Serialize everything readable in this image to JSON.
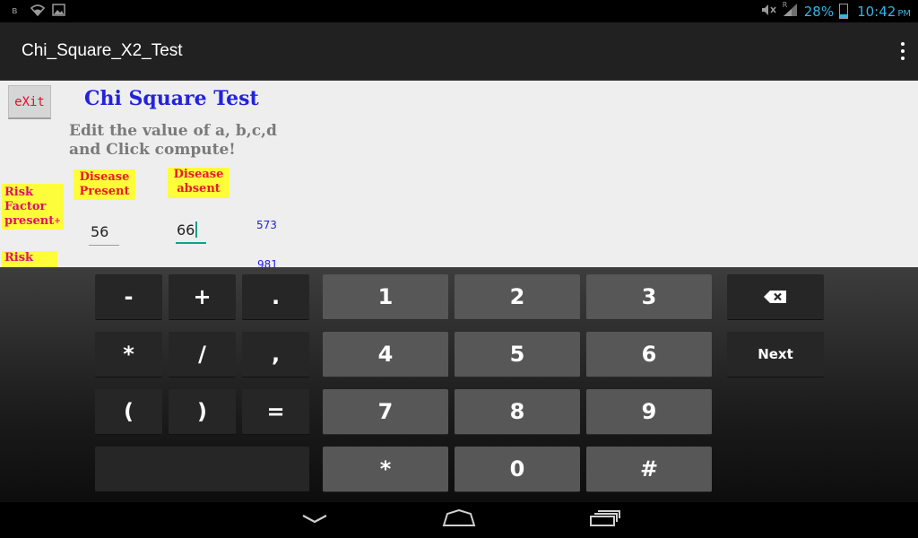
{
  "status_bar": {
    "left_icons": [
      "bluetooth-icon",
      "wifi-icon",
      "image-icon"
    ],
    "bluetooth_glyph": "ʙ",
    "battery_percent": "28%",
    "battery_level": 0.28,
    "time": "10:42",
    "ampm": "PM",
    "signal_label": "R"
  },
  "action_bar": {
    "title": "Chi_Square_X2_Test"
  },
  "content": {
    "exit_label": "eXit",
    "title": "Chi Square Test",
    "instruction_line1": "Edit the value of a, b,c,d",
    "instruction_line2": "and Click compute!",
    "label_disease_present": "Disease Present",
    "label_disease_absent": "Disease absent",
    "label_risk_factor_present": "Risk Factor present",
    "label_risk_factor_present_plus": "+",
    "label_risk_2": "Risk",
    "field_a_value": "56",
    "field_b_value": "66",
    "total_1": "573",
    "total_2": "981"
  },
  "keyboard": {
    "minus": "-",
    "plus": "+",
    "dot": ".",
    "star_sym": "*",
    "slash": "/",
    "comma": ",",
    "lparen": "(",
    "rparen": ")",
    "equals": "=",
    "k1": "1",
    "k2": "2",
    "k3": "3",
    "k4": "4",
    "k5": "5",
    "k6": "6",
    "k7": "7",
    "k8": "8",
    "k9": "9",
    "star": "*",
    "k0": "0",
    "hash": "#",
    "next": "Next"
  },
  "colors": {
    "accent_blue": "#33b5e5",
    "title_blue": "#2323dc",
    "label_yellow": "#fdfd3a",
    "label_red": "#e81b2b",
    "cursor_teal": "#10a08a"
  }
}
